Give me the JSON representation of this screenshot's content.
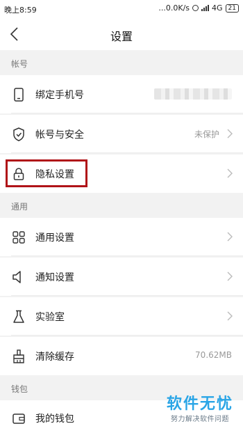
{
  "status_bar": {
    "time": "晚上8:59",
    "network_speed": "...0.0K/s",
    "network_type": "4G",
    "battery": "21"
  },
  "header": {
    "title": "设置"
  },
  "sections": {
    "account": {
      "title": "帐号",
      "items": [
        {
          "label": "绑定手机号",
          "icon": "phone-icon",
          "value": ""
        },
        {
          "label": "帐号与安全",
          "icon": "shield-icon",
          "value": "未保护"
        },
        {
          "label": "隐私设置",
          "icon": "lock-icon",
          "value": ""
        }
      ]
    },
    "general": {
      "title": "通用",
      "items": [
        {
          "label": "通用设置",
          "icon": "grid-icon",
          "value": ""
        },
        {
          "label": "通知设置",
          "icon": "speaker-icon",
          "value": ""
        },
        {
          "label": "实验室",
          "icon": "flask-icon",
          "value": ""
        },
        {
          "label": "清除缓存",
          "icon": "broom-icon",
          "value": "70.62MB"
        }
      ]
    },
    "wallet": {
      "title": "钱包",
      "items": [
        {
          "label": "我的钱包",
          "icon": "wallet-icon",
          "value": ""
        }
      ]
    }
  },
  "watermark": {
    "title": "软件无忧",
    "subtitle": "努力解决软件问题"
  },
  "colors": {
    "highlight": "#b01318",
    "watermark": "#2aa5e6"
  }
}
